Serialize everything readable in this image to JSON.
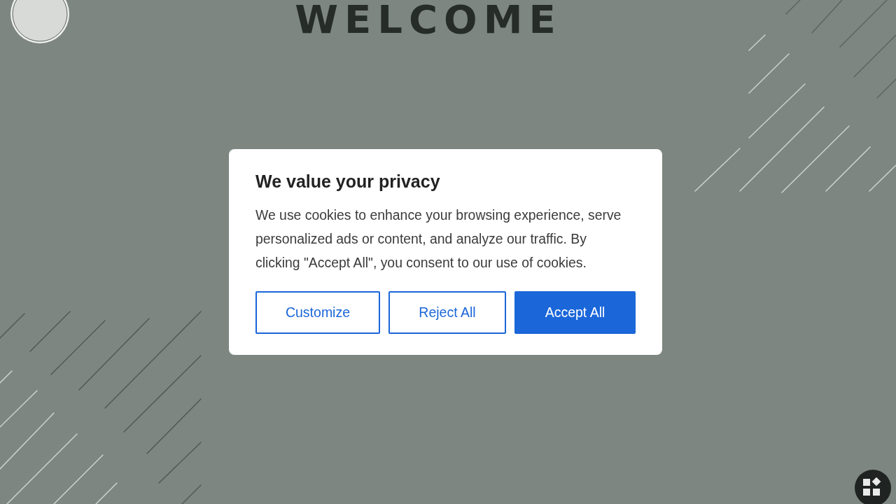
{
  "page": {
    "heading": "WELCOME"
  },
  "cookie_dialog": {
    "title": "We value your privacy",
    "message": "We use cookies to enhance your browsing experience, serve personalized ads or content, and analyze our traffic. By clicking \"Accept All\", you consent to our use of cookies.",
    "buttons": [
      {
        "label": "Customize",
        "kind": "outline"
      },
      {
        "label": "Reject All",
        "kind": "outline"
      },
      {
        "label": "Accept All",
        "kind": "primary"
      }
    ]
  }
}
